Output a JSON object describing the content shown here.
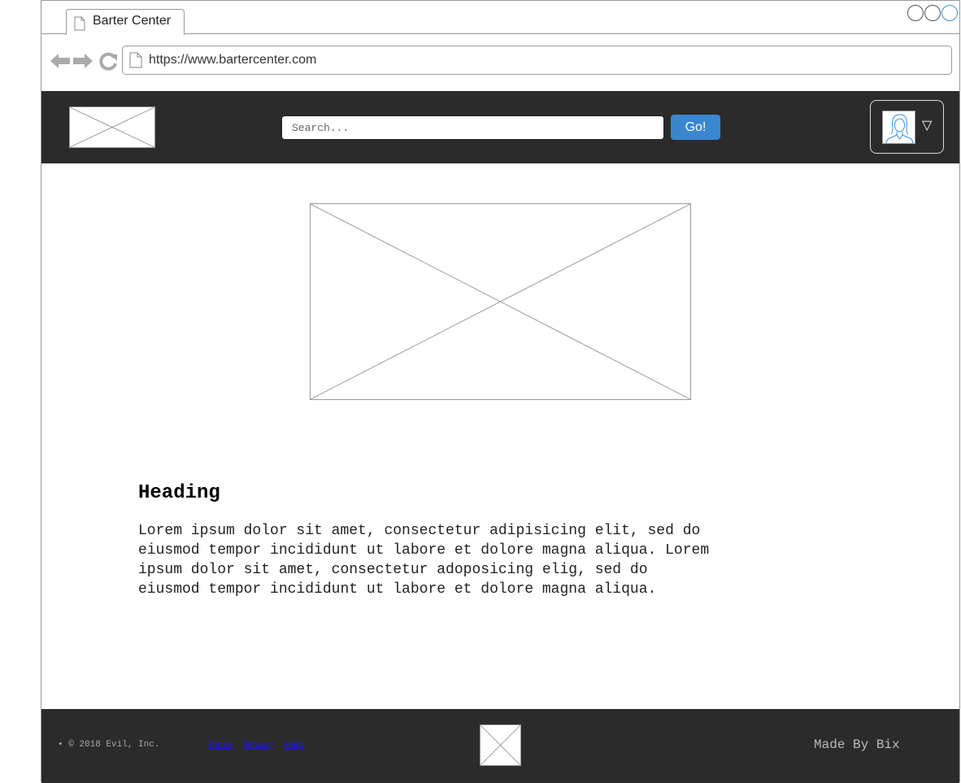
{
  "browser": {
    "tab_title": "Barter Center",
    "url": "https://www.bartercenter.com",
    "window_buttons": [
      "minimize",
      "maximize",
      "close"
    ]
  },
  "header": {
    "search_placeholder": "Search...",
    "go_label": "Go!",
    "user_menu_caret": "▽"
  },
  "content": {
    "heading": "Heading",
    "body": "Lorem ipsum dolor sit amet, consectetur adipisicing elit, sed do\neiusmod tempor incididunt ut labore et dolore magna aliqua. Lorem\nipsum dolor sit amet, consectetur adoposicing elig, sed do\neiusmod tempor incididunt ut labore et dolore magna aliqua."
  },
  "footer": {
    "copyright": "• © 2018 Evil, Inc.",
    "links": [
      "Terms",
      "Privacy",
      "Help"
    ],
    "made_by": "Made By Bix"
  },
  "colors": {
    "header_bg": "#2b2b2b",
    "go_button": "#3a87cf",
    "link": "#1a1aee",
    "active_window_button": "#3a8fd8"
  }
}
